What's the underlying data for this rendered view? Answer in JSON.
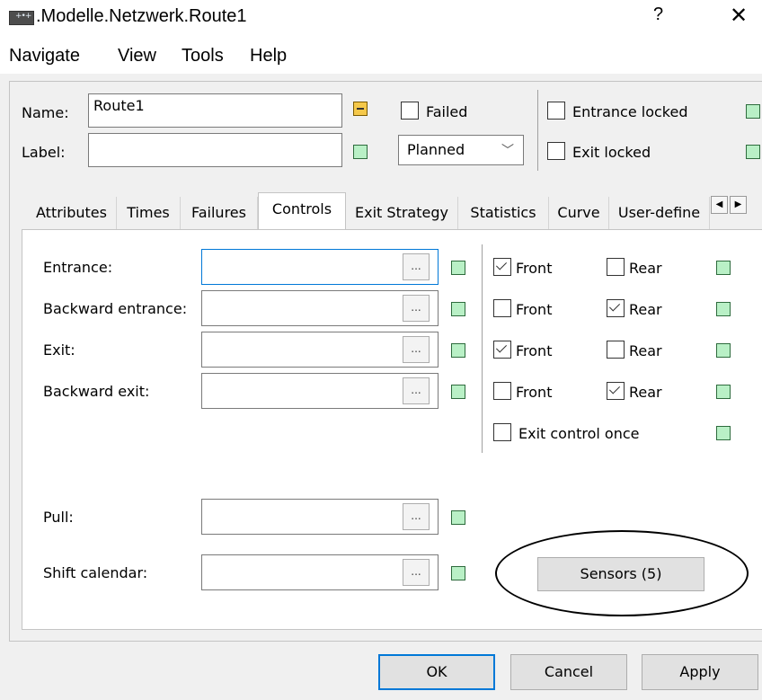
{
  "window": {
    "title": ".Modelle.Netzwerk.Route1",
    "help_label": "?",
    "close_label": "✕",
    "app_icon_glyph": "+•+"
  },
  "menu": [
    "Navigate",
    "View",
    "Tools",
    "Help"
  ],
  "header": {
    "name_label": "Name:",
    "name_value": "Route1",
    "label_label": "Label:",
    "label_value": "",
    "failed_label": "Failed",
    "failed_checked": false,
    "state_value": "Planned",
    "entrance_locked_label": "Entrance locked",
    "entrance_locked_checked": false,
    "exit_locked_label": "Exit locked",
    "exit_locked_checked": false
  },
  "tabs": [
    {
      "label": "Attributes"
    },
    {
      "label": "Times"
    },
    {
      "label": "Failures"
    },
    {
      "label": "Controls",
      "active": true
    },
    {
      "label": "Exit Strategy"
    },
    {
      "label": "Statistics"
    },
    {
      "label": "Curve"
    },
    {
      "label": "User-define"
    }
  ],
  "tab_scroll": {
    "left": "◀",
    "right": "▶"
  },
  "controls": {
    "rows": [
      {
        "label": "Entrance:",
        "value": "",
        "front_label": "Front",
        "front_checked": true,
        "rear_label": "Rear",
        "rear_checked": false
      },
      {
        "label": "Backward entrance:",
        "value": "",
        "front_label": "Front",
        "front_checked": false,
        "rear_label": "Rear",
        "rear_checked": true
      },
      {
        "label": "Exit:",
        "value": "",
        "front_label": "Front",
        "front_checked": true,
        "rear_label": "Rear",
        "rear_checked": false
      },
      {
        "label": "Backward exit:",
        "value": "",
        "front_label": "Front",
        "front_checked": false,
        "rear_label": "Rear",
        "rear_checked": true
      }
    ],
    "exit_control_once_label": "Exit control once",
    "exit_control_once_checked": false,
    "pull_label": "Pull:",
    "pull_value": "",
    "shift_calendar_label": "Shift calendar:",
    "shift_calendar_value": "",
    "ellipsis_label": "...",
    "sensors_label": "Sensors (5)"
  },
  "footer": {
    "ok_label": "OK",
    "cancel_label": "Cancel",
    "apply_label": "Apply"
  },
  "colors": {
    "status_green": "#b9f0c6",
    "status_orange": "#f5c84a",
    "accent": "#0078d7"
  }
}
